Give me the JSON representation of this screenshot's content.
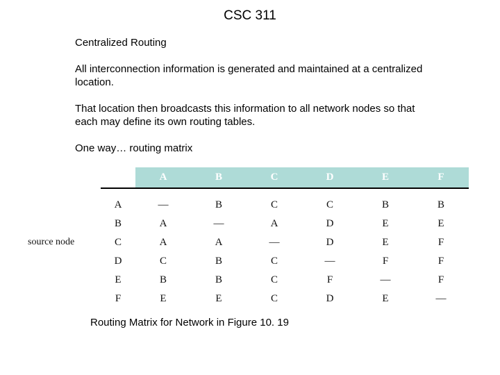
{
  "title": "CSC 311",
  "heading": "Centralized Routing",
  "para1": "All interconnection information is generated and maintained at a centralized location.",
  "para2": "That location then broadcasts this information to all network nodes so that each may define its own routing tables.",
  "para3": "One way… routing matrix",
  "sourceLabel": "source node",
  "caption": "Routing Matrix for  Network in Figure 10. 19",
  "matrix": {
    "cols": [
      "A",
      "B",
      "C",
      "D",
      "E",
      "F"
    ],
    "rows": [
      {
        "label": "A",
        "cells": [
          "—",
          "B",
          "C",
          "C",
          "B",
          "B"
        ]
      },
      {
        "label": "B",
        "cells": [
          "A",
          "—",
          "A",
          "D",
          "E",
          "E"
        ]
      },
      {
        "label": "C",
        "cells": [
          "A",
          "A",
          "—",
          "D",
          "E",
          "F"
        ]
      },
      {
        "label": "D",
        "cells": [
          "C",
          "B",
          "C",
          "—",
          "F",
          "F"
        ]
      },
      {
        "label": "E",
        "cells": [
          "B",
          "B",
          "C",
          "F",
          "—",
          "F"
        ]
      },
      {
        "label": "F",
        "cells": [
          "E",
          "E",
          "C",
          "D",
          "E",
          "—"
        ]
      }
    ]
  }
}
